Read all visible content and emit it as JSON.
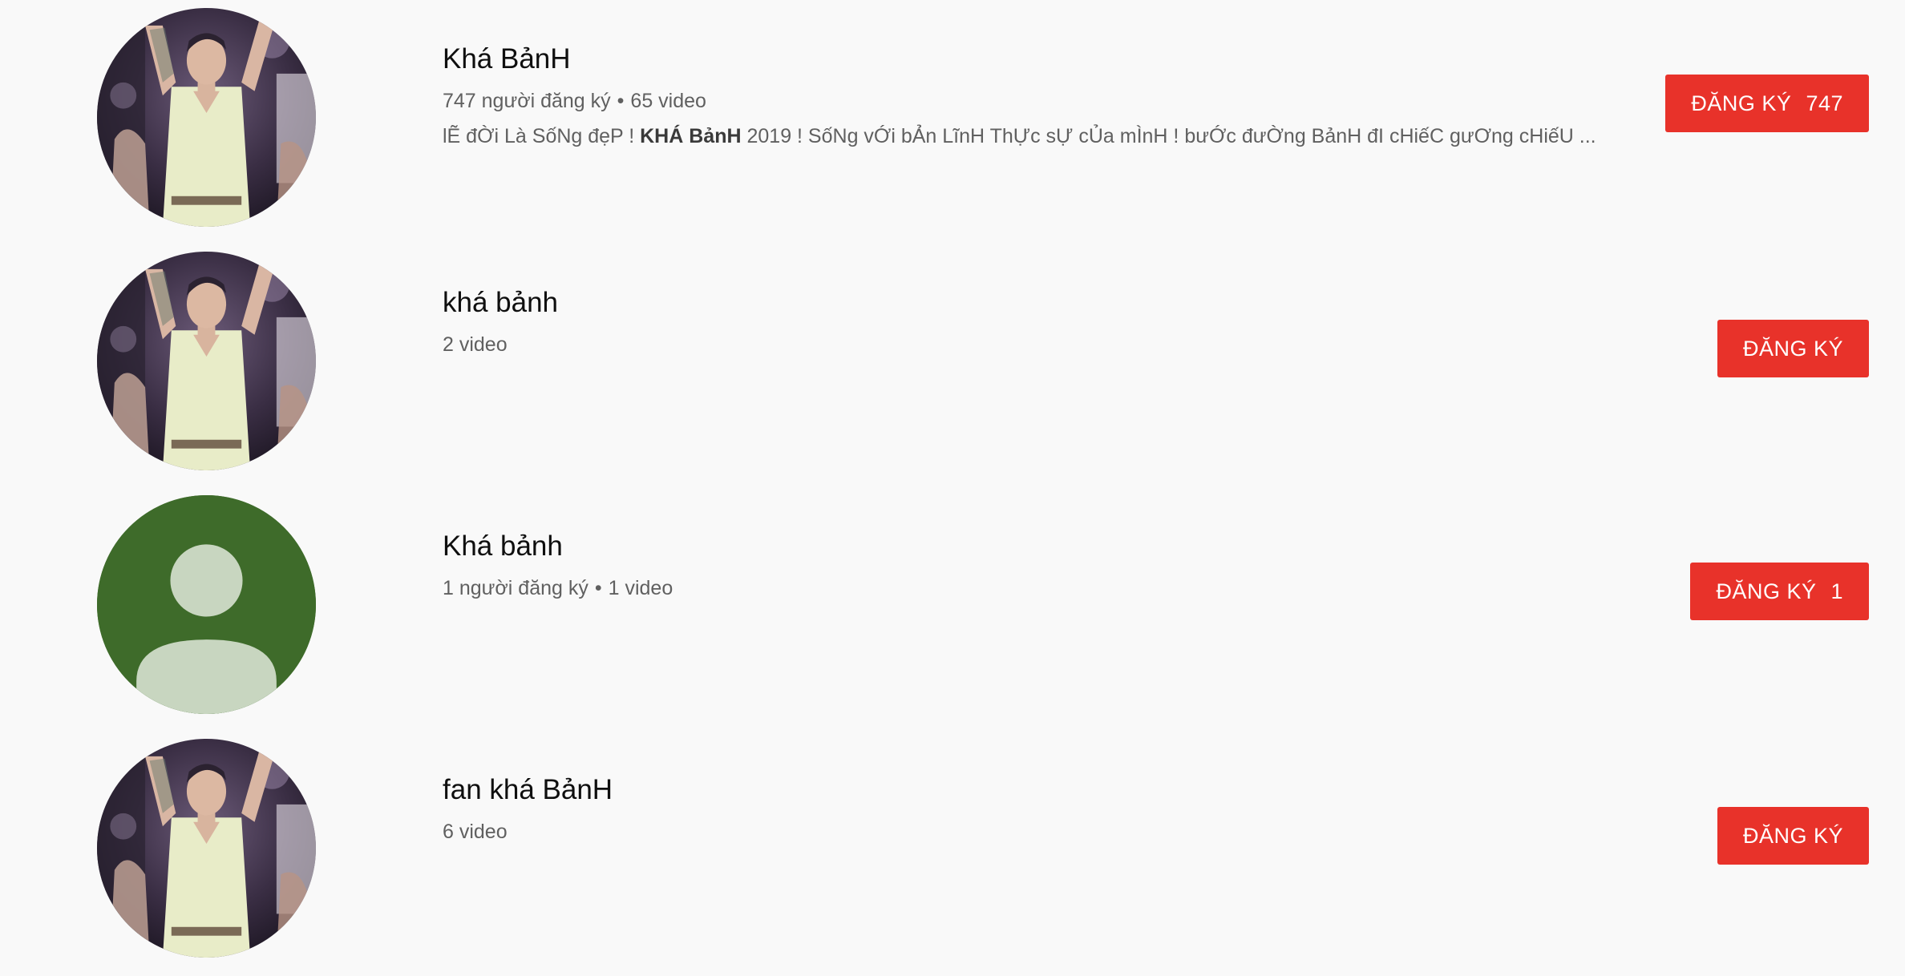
{
  "channels": [
    {
      "name": "Khá BảnH",
      "subscribers": "747 người đăng ký",
      "videos": "65 video",
      "description_pre": "lẼ đỜi Là SốNg đẹP ! ",
      "description_bold": "KHÁ BảnH",
      "description_post": " 2019 ! SốNg vỚi bẢn LĩnH ThỰc sỰ cỦa mÌnH ! bưỚc đưỜng BảnH đI cHiếC gưƠng cHiếU ...",
      "subscribe_label": "ĐĂNG KÝ",
      "subscribe_count": "747",
      "avatar": "person-photo-icon"
    },
    {
      "name": "khá bảnh",
      "videos": "2 video",
      "subscribe_label": "ĐĂNG KÝ",
      "avatar": "person-photo-icon"
    },
    {
      "name": "Khá bảnh",
      "subscribers": "1 người đăng ký",
      "videos": "1 video",
      "subscribe_label": "ĐĂNG KÝ",
      "subscribe_count": "1",
      "avatar": "default-user-icon"
    },
    {
      "name": "fan khá BảnH",
      "videos": "6 video",
      "subscribe_label": "ĐĂNG KÝ",
      "avatar": "person-photo-icon"
    }
  ],
  "meta_separator": "•",
  "colors": {
    "subscribe_button": "#e8322a",
    "default_avatar_bg": "#3e6b2a",
    "default_avatar_fg": "#c8d6c0",
    "page_background": "#f9f9f9"
  }
}
